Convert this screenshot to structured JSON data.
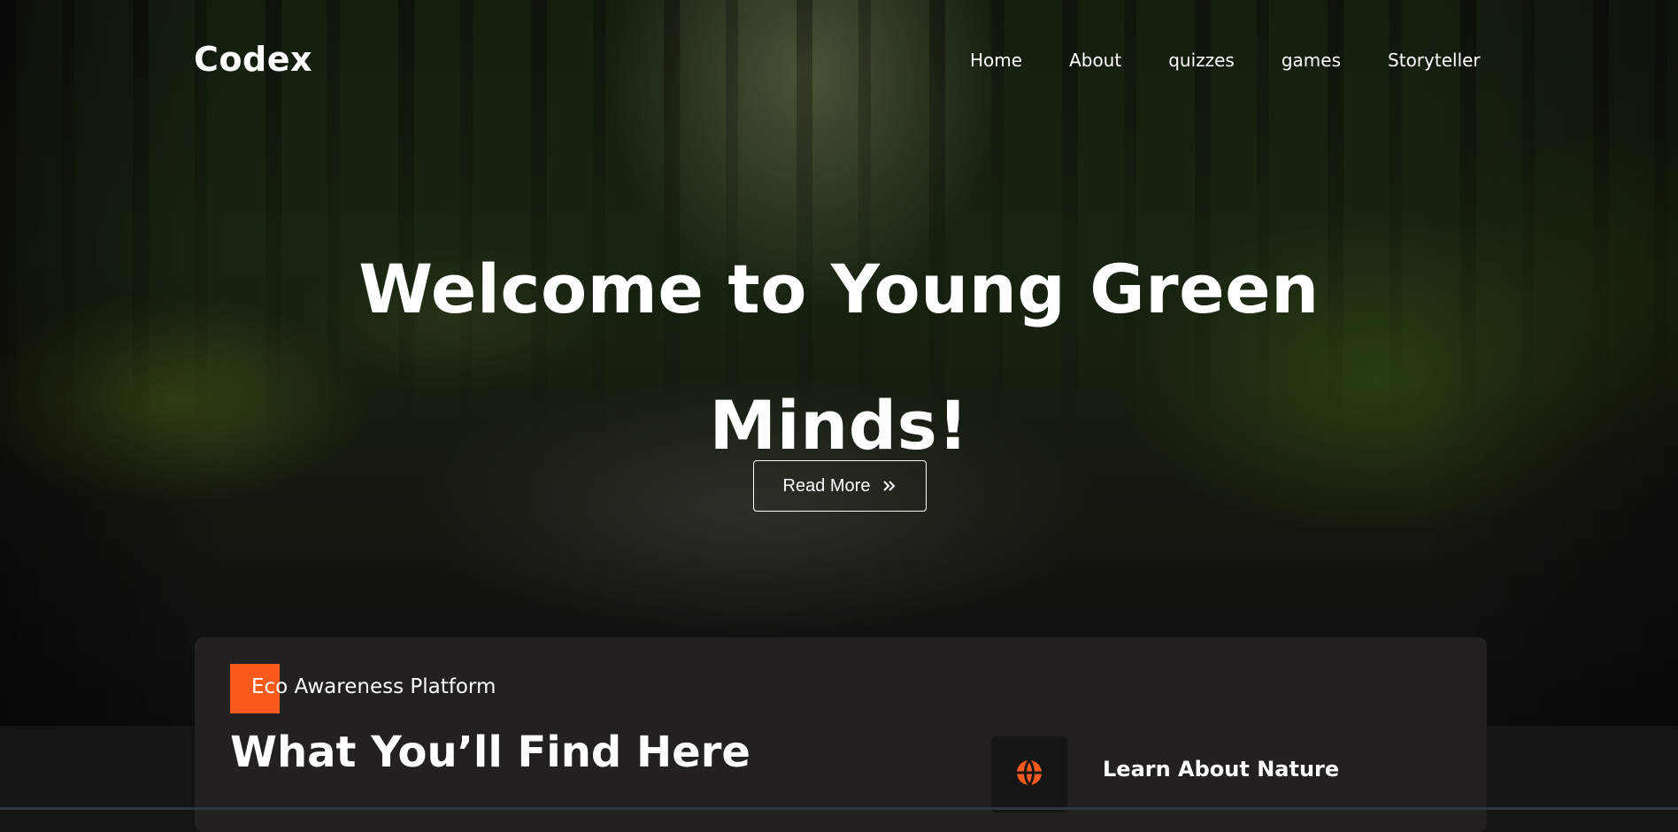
{
  "brand": {
    "logo": "Codex"
  },
  "nav": {
    "items": [
      "Home",
      "About",
      "quizzes",
      "games",
      "Storyteller"
    ]
  },
  "hero": {
    "title": "Welcome to Young Green Minds!",
    "cta_label": "Read More",
    "cta_icon": "double-chevron-right-icon"
  },
  "section": {
    "tag": "Eco Awareness Platform",
    "title": "What You’ll Find Here",
    "feature": {
      "label": "Learn About Nature",
      "icon": "globe-icon"
    }
  },
  "colors": {
    "accent": "#fb5a1c",
    "card_bg": "#222120",
    "page_bg": "#141414"
  }
}
